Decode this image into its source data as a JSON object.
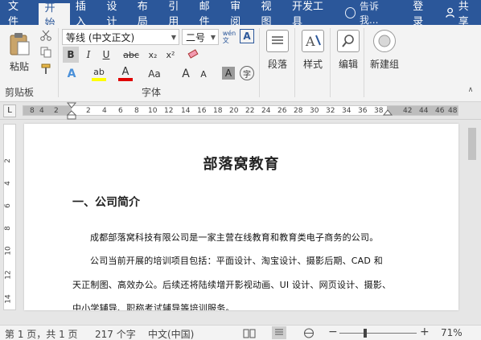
{
  "menu": {
    "tabs": [
      "文件",
      "开始",
      "插入",
      "设计",
      "布局",
      "引用",
      "邮件",
      "审阅",
      "视图",
      "开发工具"
    ],
    "active_index": 1,
    "tell_me": "告诉我...",
    "login": "登录",
    "share": "共享"
  },
  "ribbon": {
    "clipboard": {
      "paste_label": "粘贴",
      "group_label": "剪贴板"
    },
    "font": {
      "font_name": "等线 (中文正文)",
      "font_size": "二号",
      "wen_char": "wén\n文",
      "a_box": "A",
      "bold": "B",
      "italic": "I",
      "underline": "U",
      "strike": "abc",
      "subscript": "x₂",
      "superscript": "x²",
      "text_effect": "A",
      "highlight": "ab",
      "font_color": "A",
      "change_case": "Aa",
      "grow": "A",
      "shrink": "A",
      "char_shading": "A",
      "enclose": "字",
      "group_label": "字体"
    },
    "paragraph_label": "段落",
    "styles_label": "样式",
    "editing_label": "编辑",
    "newgroup_label": "新建组"
  },
  "ruler": {
    "tab_selector": "L",
    "ticks": [
      "8",
      "4",
      "2",
      "2",
      "4",
      "6",
      "8",
      "10",
      "12",
      "14",
      "16",
      "18",
      "20",
      "22",
      "24",
      "26",
      "28",
      "30",
      "32",
      "34",
      "36",
      "38",
      "42",
      "44",
      "46",
      "48"
    ],
    "vticks": [
      "2",
      "4",
      "6",
      "8",
      "10",
      "12",
      "14"
    ]
  },
  "document": {
    "title": "部落窝教育",
    "heading": "一、公司简介",
    "paragraphs": [
      "成都部落窝科技有限公司是一家主营在线教育和教育类电子商务的公司。",
      "公司当前开展的培训项目包括：平面设计、淘宝设计、摄影后期、CAD 和",
      "天正制图、高效办公。后续还将陆续增开影视动画、UI 设计、网页设计、摄影、",
      "中小学辅导、职称考试辅导等培训服务。"
    ]
  },
  "status": {
    "page": "第 1 页，共 1 页",
    "words": "217 个字",
    "language": "中文(中国)",
    "zoom": "71%",
    "zoom_minus": "−",
    "zoom_plus": "+"
  },
  "colors": {
    "brand": "#2b579a",
    "highlight_yellow": "#ffff00",
    "font_red": "#e00000"
  }
}
